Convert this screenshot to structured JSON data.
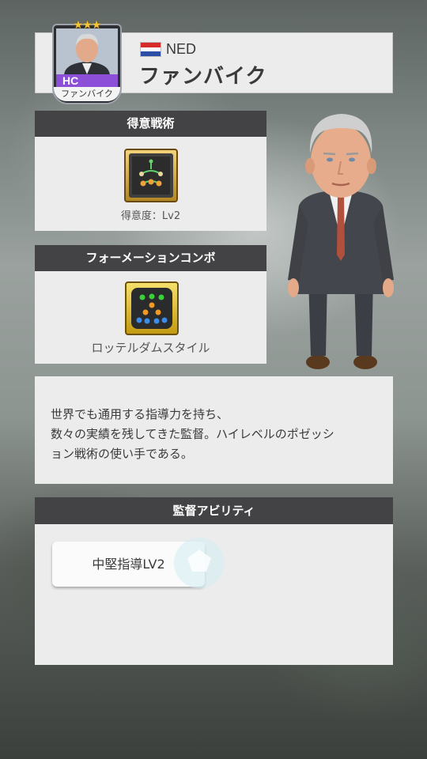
{
  "header": {
    "nation": "NED",
    "name": "ファンバイク",
    "flag_colors": [
      "#d52b2b",
      "#ffffff",
      "#2b4fa6"
    ]
  },
  "card": {
    "stars": "★★★",
    "position": "HC",
    "name": "ファンバイク"
  },
  "specialty": {
    "title": "得意戦術",
    "icon": "tactic-board-icon",
    "level_label": "得意度：Lv2"
  },
  "formation": {
    "title": "フォーメーションコンボ",
    "icon": "formation-dots-icon",
    "name": "ロッテルダムスタイル"
  },
  "description": {
    "line1": "世界でも通用する指導力を持ち、",
    "line2": "数々の実績を残してきた監督。ハイレベルのポゼッシ",
    "line3": "ョン戦術の使い手である。"
  },
  "ability": {
    "title": "監督アビリティ",
    "items": [
      {
        "label": "中堅指導LV2"
      }
    ]
  }
}
